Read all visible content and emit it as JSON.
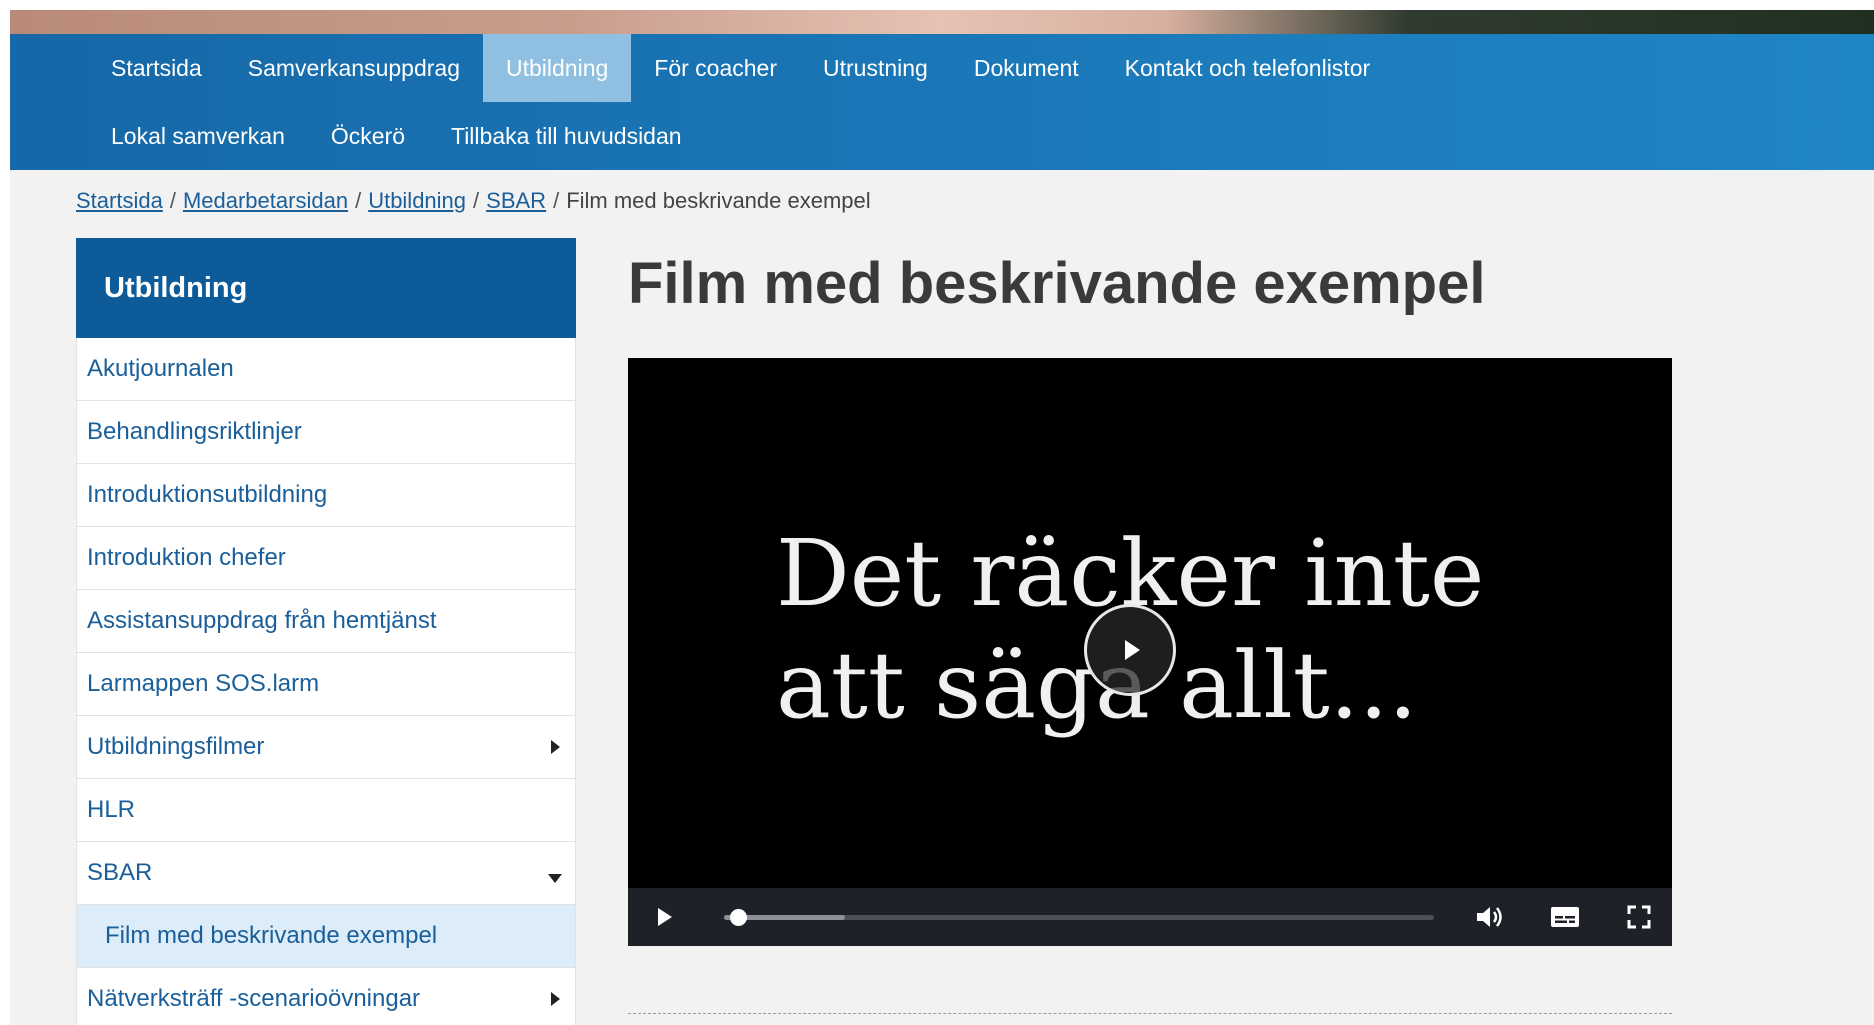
{
  "colors": {
    "nav_bg": "#1f7fc2",
    "nav_active": "#8fc0e2",
    "sidebar_head": "#0d5c99",
    "link": "#1b5f9a",
    "sidebar_selected": "#dcecf8"
  },
  "topnav": {
    "row1": [
      {
        "label": "Startsida"
      },
      {
        "label": "Samverkansuppdrag"
      },
      {
        "label": "Utbildning",
        "active": true
      },
      {
        "label": "För coacher"
      },
      {
        "label": "Utrustning"
      },
      {
        "label": "Dokument"
      },
      {
        "label": "Kontakt och telefonlistor"
      }
    ],
    "row2": [
      {
        "label": "Lokal samverkan"
      },
      {
        "label": "Öckerö"
      },
      {
        "label": "Tillbaka till huvudsidan"
      }
    ]
  },
  "breadcrumb": {
    "links": [
      "Startsida",
      "Medarbetarsidan",
      "Utbildning",
      "SBAR"
    ],
    "separator": "/",
    "current": "Film med beskrivande exempel"
  },
  "sidebar": {
    "title": "Utbildning",
    "items": [
      {
        "label": "Akutjournalen"
      },
      {
        "label": "Behandlingsriktlinjer"
      },
      {
        "label": "Introduktionsutbildning"
      },
      {
        "label": "Introduktion chefer"
      },
      {
        "label": "Assistansuppdrag från hemtjänst"
      },
      {
        "label": "Larmappen SOS.larm"
      },
      {
        "label": "Utbildningsfilmer",
        "icon": "chevron-right-icon"
      },
      {
        "label": "HLR"
      },
      {
        "label": "SBAR",
        "icon": "chevron-down-icon"
      },
      {
        "label": "Film med beskrivande exempel",
        "selected": true
      },
      {
        "label": "Nätverksträff -scenarioövningar",
        "icon": "chevron-right-icon"
      }
    ]
  },
  "main": {
    "title": "Film med beskrivande exempel"
  },
  "video": {
    "caption_line1": "Det räcker inte",
    "caption_line2": "att säga allt...",
    "progress": 0.02,
    "buffered": 0.17,
    "controls": [
      "play-icon",
      "volume-icon",
      "captions-icon",
      "fullscreen-icon"
    ]
  }
}
